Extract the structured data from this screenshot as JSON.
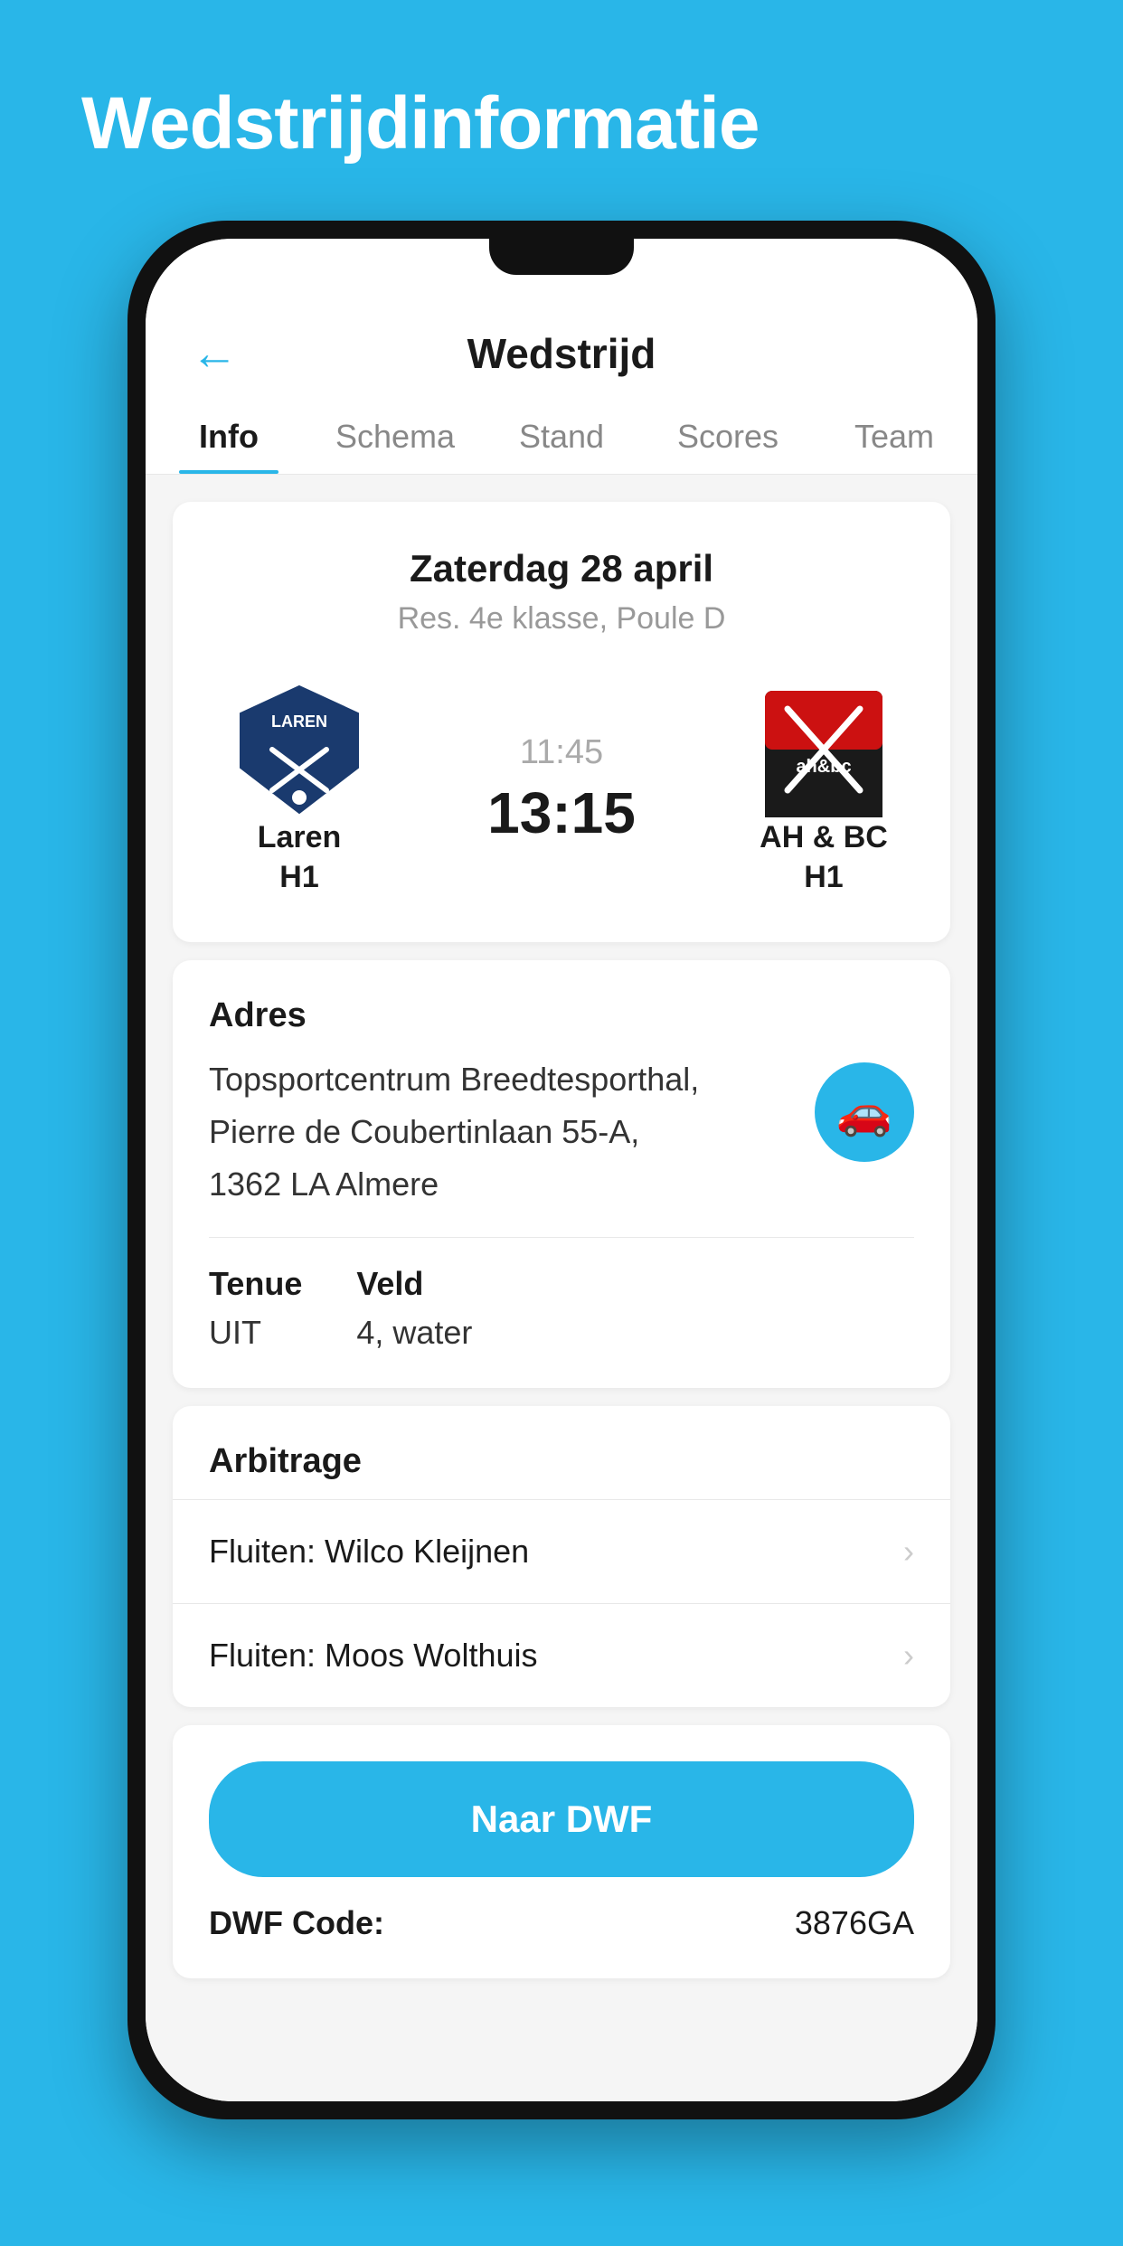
{
  "page": {
    "background_title": "Wedstrijdinformatie"
  },
  "header": {
    "back_label": "←",
    "title": "Wedstrijd"
  },
  "tabs": [
    {
      "label": "Info",
      "active": true
    },
    {
      "label": "Schema",
      "active": false
    },
    {
      "label": "Stand",
      "active": false
    },
    {
      "label": "Scores",
      "active": false
    },
    {
      "label": "Team",
      "active": false
    }
  ],
  "match": {
    "date": "Zaterdag 28 april",
    "league": "Res. 4e klasse, Poule D",
    "home_team": "Laren",
    "home_team_sub": "H1",
    "away_team": "AH & BC",
    "away_team_sub": "H1",
    "time_planned": "11:45",
    "score": "13:15"
  },
  "address": {
    "label": "Adres",
    "text_line1": "Topsportcentrum Breedtesporthal,",
    "text_line2": "Pierre de Coubertinlaan 55-A,",
    "text_line3": "1362 LA Almere"
  },
  "tenue": {
    "label": "Tenue",
    "value": "UIT"
  },
  "veld": {
    "label": "Veld",
    "value": "4, water"
  },
  "arbitrage": {
    "label": "Arbitrage",
    "items": [
      {
        "text": "Fluiten: Wilco Kleijnen"
      },
      {
        "text": "Fluiten: Moos Wolthuis"
      }
    ]
  },
  "dwf": {
    "button_label": "Naar DWF",
    "code_label": "DWF Code:",
    "code_value": "3876GA"
  },
  "colors": {
    "primary": "#29b6e8",
    "text_dark": "#1a1a1a",
    "text_gray": "#999"
  }
}
